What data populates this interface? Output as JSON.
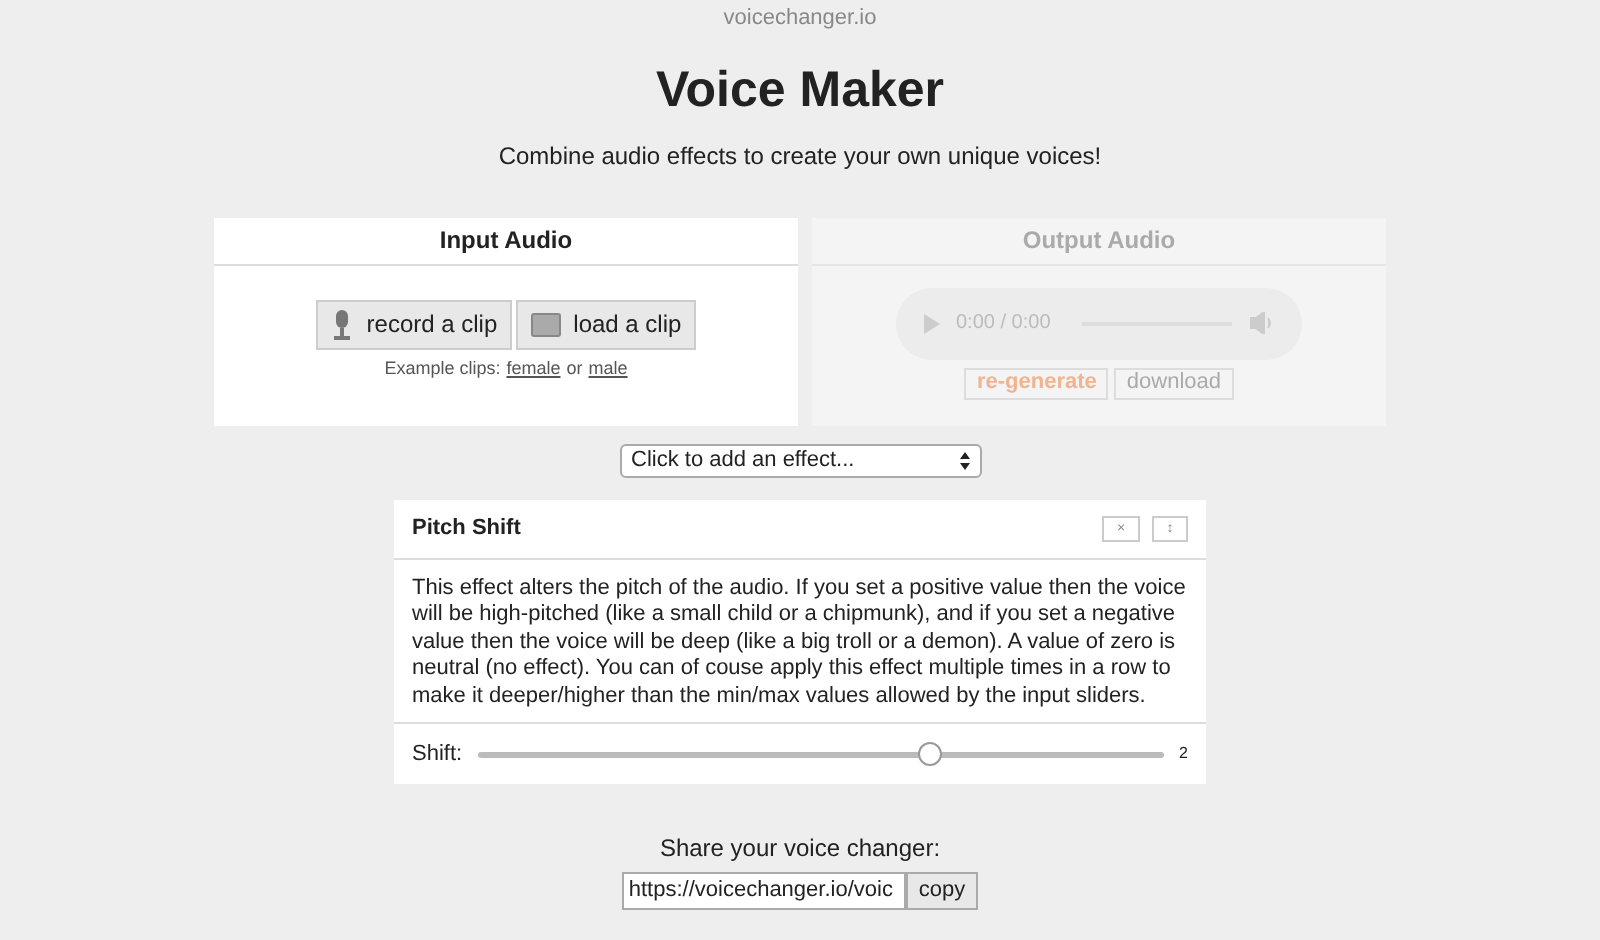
{
  "site": "voicechanger.io",
  "title": "Voice Maker",
  "subtitle": "Combine audio effects to create your own unique voices!",
  "input_panel": {
    "title": "Input Audio",
    "buttons": [
      {
        "kind": "mic",
        "label": "record a clip"
      },
      {
        "kind": "folder",
        "label": "load a clip"
      }
    ],
    "examples_label": "Example clips:",
    "examples": [
      "female",
      "male"
    ],
    "joiner": "or"
  },
  "output_panel": {
    "title": "Output Audio",
    "disabled": true,
    "player_time": "0:00 / 0:00",
    "buttons": [
      {
        "kind": "primary",
        "label": "re-generate"
      },
      {
        "kind": "plain",
        "label": "download"
      }
    ]
  },
  "effect_select": {
    "value": "Click to add an effect..."
  },
  "effects": [
    {
      "title": "Pitch Shift",
      "close": "×",
      "move": "↕",
      "description": "This effect alters the pitch of the audio. If you set a positive value then the voice will be high-pitched (like a small child or a chipmunk), and if you set a negative value then the voice will be deep (like a big troll or a demon). A value of zero is neutral (no effect). You can of couse apply this effect multiple times in a row to make it deeper/higher than the min/max values allowed by the input sliders.",
      "param_label": "Shift:",
      "level": 0.66,
      "reading": "2"
    }
  ],
  "share": {
    "label": "Share your voice changer:",
    "url": "https://voicechanger.io/voic",
    "button": "copy"
  }
}
